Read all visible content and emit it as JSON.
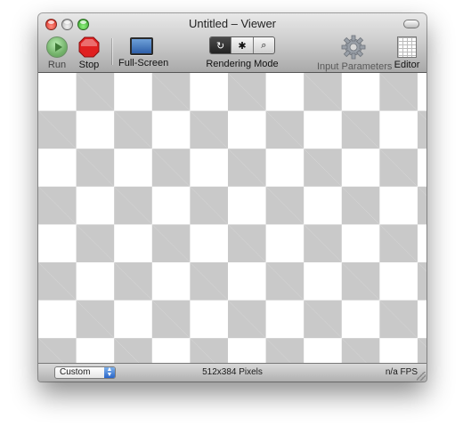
{
  "window": {
    "title": "Untitled – Viewer"
  },
  "toolbar": {
    "run_label": "Run",
    "stop_label": "Stop",
    "fullscreen_label": "Full-Screen",
    "rendering_mode_label": "Rendering Mode",
    "rendering_modes": [
      {
        "icon": "refresh-icon",
        "glyph": "↻",
        "selected": true
      },
      {
        "icon": "bug-icon",
        "glyph": "✱",
        "selected": false
      },
      {
        "icon": "magnifier-icon",
        "glyph": "⌕",
        "selected": false
      }
    ],
    "input_parameters_label": "Input Parameters",
    "editor_label": "Editor"
  },
  "statusbar": {
    "size_mode": "Custom",
    "pixels": "512x384 Pixels",
    "fps": "n/a FPS"
  },
  "colors": {
    "checker_light": "#ffffff",
    "checker_dark": "#c9c9c9",
    "stop_red": "#e02020",
    "run_green": "#74b36b"
  }
}
